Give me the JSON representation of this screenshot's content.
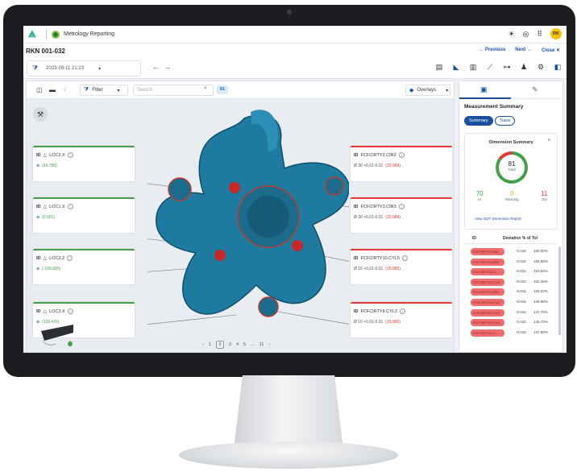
{
  "app": {
    "title": "Metrology Reporting",
    "avatar": "RK"
  },
  "appbar_icons": [
    "sun-icon",
    "globe-icon",
    "grid-icon"
  ],
  "page": {
    "title": "RKN 001-032",
    "previous": "← Previous",
    "next": "Next →",
    "close": "Close ✕"
  },
  "toolbar": {
    "date": "2023-09-11 21:23"
  },
  "viewer": {
    "filter_label": "Filter",
    "search_placeholder": "Search",
    "count": "81",
    "overlays_label": "Overlays"
  },
  "cards": [
    {
      "id": "LOC2.X",
      "value": "(49.756)",
      "status": "ok"
    },
    {
      "id": "LOC1.X",
      "value": "(0.001)",
      "status": "ok"
    },
    {
      "id": "LOC2.Z",
      "value": "(-100.005)",
      "status": "ok"
    },
    {
      "id": "LOC3.X",
      "value": "(118.470)",
      "status": "ok"
    },
    {
      "id": "FCFCIRTY2.CIR2",
      "value": "Ø 30 +0.01-0.01",
      "extra": "(29.984)",
      "status": "bad"
    },
    {
      "id": "FCFCIRTY3.CIR3",
      "value": "Ø 30 +0.01-0.01",
      "extra": "(29.984)",
      "status": "bad"
    },
    {
      "id": "FCFCIRTY10.CYL5",
      "value": "Ø 16 +0.01-0.01",
      "extra": "(15.985)",
      "status": "bad"
    },
    {
      "id": "FCFCIRTY6.CYL2",
      "value": "Ø 16 +0.01-0.01",
      "extra": "(15.985)",
      "status": "bad"
    }
  ],
  "pager": {
    "prev": "‹",
    "pages": [
      "1",
      "2",
      "3",
      "4",
      "5",
      "...",
      "11"
    ],
    "current": "2",
    "next": "›"
  },
  "panel": {
    "title": "Measurement Summary",
    "tab_summary": "Summary",
    "tab_trace": "Trace",
    "dim_title": "Dimension Summary",
    "total": "81",
    "total_label": "Total",
    "in_value": "70",
    "in_label": "In",
    "warn_value": "0",
    "warn_label": "Warning",
    "out_value": "11",
    "out_label": "Out",
    "link": "View GDT Dimension Report",
    "col_id": "ID",
    "col_dev": "Deviation % of Tol",
    "rows": [
      {
        "id": "FCFCIRTY2.CIR2",
        "value": "-0.016",
        "pct": "155.00%"
      },
      {
        "id": "FCFCIRTY3.CIR3",
        "value": "-0.016",
        "pct": "155.88%"
      },
      {
        "id": "FCFCIRTY10.C...",
        "value": "-0.015",
        "pct": "153.94%"
      },
      {
        "id": "FCFCIRTY6.CYL2",
        "value": "-0.015",
        "pct": "152.36%"
      },
      {
        "id": "FCFCIRTY4.CIR4",
        "value": "-0.015",
        "pct": "150.02%"
      },
      {
        "id": "FCFCIRTY5.CYL3",
        "value": "-0.015",
        "pct": "148.98%"
      },
      {
        "id": "FCFCIRTY9.CYL4",
        "value": "-0.015",
        "pct": "147.70%"
      },
      {
        "id": "FCFCIRTY8.CYL4",
        "value": "-0.015",
        "pct": "146.70%"
      },
      {
        "id": "FCFCIRTY11.C...",
        "value": "-0.015",
        "pct": "147.60%"
      }
    ]
  },
  "colors": {
    "accent": "#1a4fa0",
    "ok": "#43a047",
    "bad": "#e53935",
    "part": "#1f7aa0"
  }
}
